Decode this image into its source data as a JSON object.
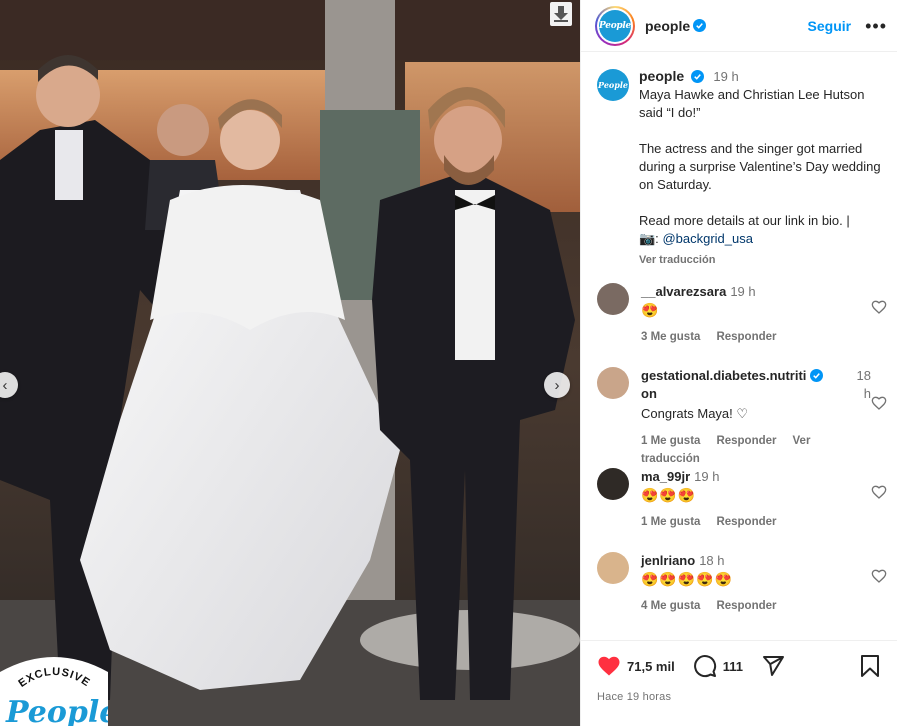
{
  "post": {
    "account": "people",
    "follow_label": "Seguir",
    "avatar_text": "People"
  },
  "caption": {
    "username": "people",
    "time": "19 h",
    "line1": "Maya Hawke and Christian Lee Hutson said “I do!”",
    "line2": "The actress and the singer got married during a surprise Valentine’s Day wedding on Saturday.",
    "line3": "Read more details at our link in bio. |",
    "camera": "📷:",
    "mention": "@backgrid_usa",
    "translate": "Ver traducción"
  },
  "comments": [
    {
      "user": "__alvarezsara",
      "time": "19 h",
      "text": "😍",
      "likes": "3 Me gusta",
      "reply": "Responder",
      "avatar_color": "#7a6a62"
    },
    {
      "user": "gestational.diabetes.nutrition",
      "user_part1": "gestational.diabetes.nutriti",
      "user_part2": "on",
      "time": "18 h",
      "time_part1": "18",
      "time_part2": "h",
      "text": "Congrats Maya! ♡",
      "likes": "1 Me gusta",
      "reply": "Responder",
      "translate": "Ver traducción",
      "avatar_color": "#c9a58a"
    },
    {
      "user": "ma_99jr",
      "time": "19 h",
      "text": "😍😍😍",
      "likes": "1 Me gusta",
      "reply": "Responder",
      "avatar_color": "#2f2a26"
    },
    {
      "user": "jenlriano",
      "time": "18 h",
      "text": "😍😍😍😍😍",
      "likes": "4 Me gusta",
      "reply": "Responder",
      "avatar_color": "#d9b48c"
    }
  ],
  "actions": {
    "likes": "71,5 mil",
    "comments": "111",
    "posted": "Hace 19 horas"
  },
  "badge": {
    "exclusive": "EXCLUSIVE",
    "brand": "People"
  },
  "colors": {
    "link": "#0095f6",
    "like_red": "#ff3040",
    "verified": "#0095f6",
    "brand_blue": "#1a9ad6"
  }
}
